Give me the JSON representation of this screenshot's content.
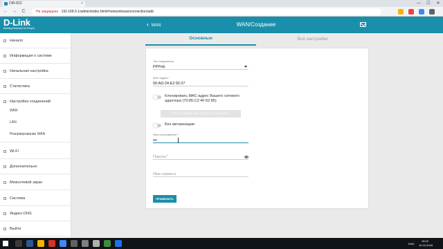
{
  "browser": {
    "tab_title": "DIR-822",
    "tab_close": "×",
    "win_min": "—",
    "win_max": "☐",
    "win_close": "✕",
    "back": "←",
    "forward": "→",
    "reload": "C",
    "security": "Не защищено",
    "url": "192.168.0.1/admin/index.html#/network/wan/connection/add"
  },
  "header": {
    "logo_main": "D-Link",
    "logo_sub": "Building Networks for People",
    "back_label": "WAN",
    "title": "WAN/Создание"
  },
  "sidebar": {
    "items": [
      {
        "label": "Начало"
      },
      {
        "label": "Информация о системе"
      },
      {
        "label": "Начальная настройка"
      },
      {
        "label": "Статистика"
      },
      {
        "label": "Настройка соединений"
      }
    ],
    "subitems": [
      {
        "label": "WAN"
      },
      {
        "label": "LAN"
      },
      {
        "label": "Резервирование WAN"
      }
    ],
    "items2": [
      {
        "label": "Wi-Fi"
      },
      {
        "label": "Дополнительно"
      },
      {
        "label": "Межсетевой экран"
      },
      {
        "label": "Система"
      },
      {
        "label": "Яндекс.DNS"
      },
      {
        "label": "Выйти"
      }
    ]
  },
  "tabs": {
    "main": "Основные",
    "all": "Все настройки"
  },
  "form": {
    "conn_type_label": "Тип соединения",
    "conn_type_value": "PPPoE",
    "mac_label": "MAC-адрес*",
    "mac_value": "00:AD:24:E2:92:27",
    "clone_mac_label_1": "Клонировать MAC-адрес Вашего сетевого",
    "clone_mac_label_2": "адаптера (70:85:C2:4F:62:85)",
    "restore_mac_button": "ВОССТАНОВИТЬ MAC-АДРЕС ПО УМОЛЧАНИЮ",
    "no_auth_label": "Без авторизации",
    "username_label": "Имя пользователя *",
    "username_value": "os",
    "password_placeholder": "Пароль*",
    "service_placeholder": "Имя сервиса",
    "apply_button": "ПРИМЕНИТЬ"
  },
  "taskbar": {
    "lang": "ENG",
    "time": "15:22",
    "date": "10.10.2018"
  },
  "colors": {
    "accent": "#1a8fab"
  }
}
